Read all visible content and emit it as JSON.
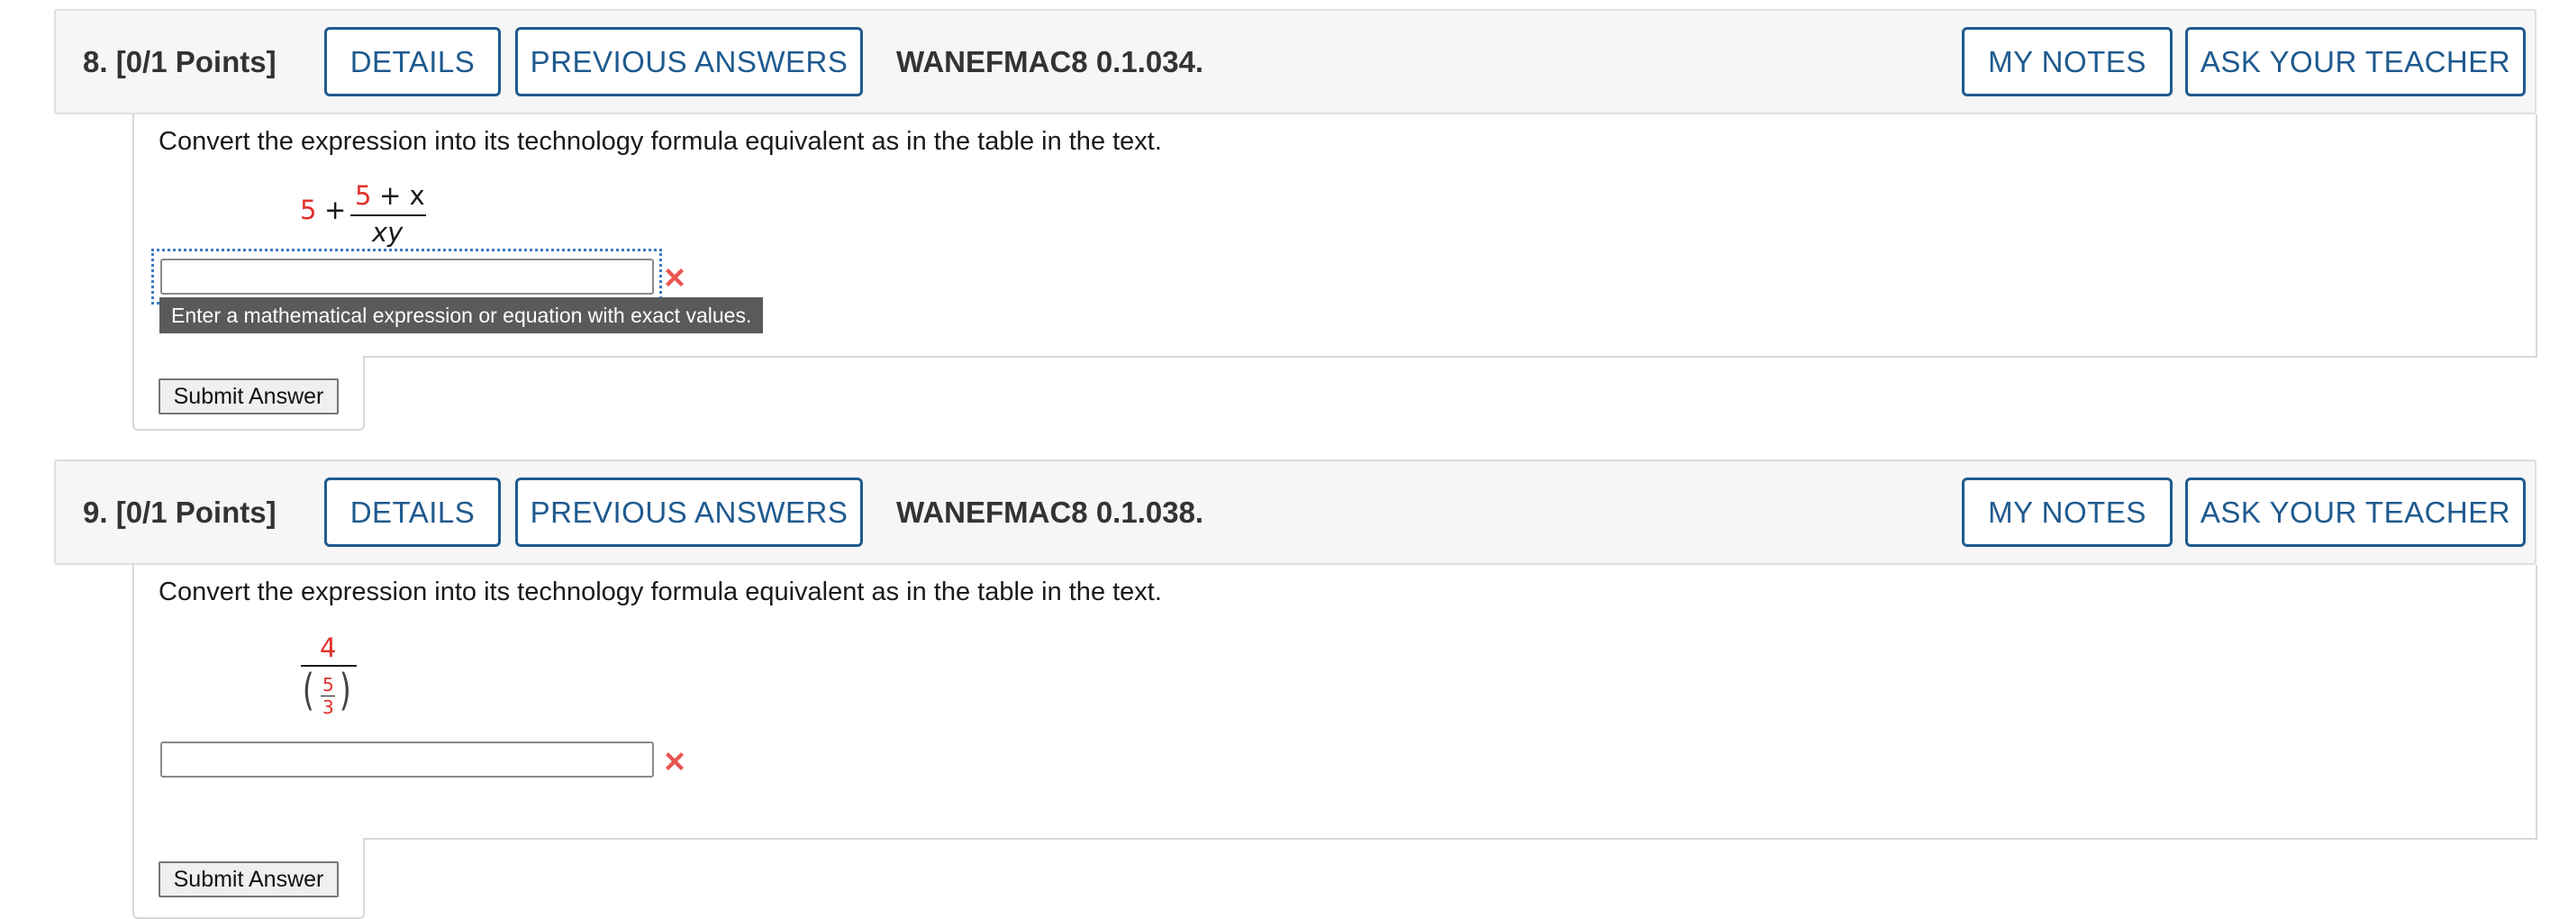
{
  "questions": [
    {
      "number_label": "8.",
      "points_label": "[0/1 Points]",
      "details_label": "DETAILS",
      "previous_answers_label": "PREVIOUS ANSWERS",
      "reference": "WANEFMAC8 0.1.034.",
      "my_notes_label": "MY NOTES",
      "ask_teacher_label": "ASK YOUR TEACHER",
      "prompt": "Convert the expression into its technology formula equivalent as in the table in the text.",
      "expression": {
        "whole": "5",
        "plus": "+",
        "numerator_a": "5",
        "numerator_op": "+ x",
        "denominator": "xy"
      },
      "answer_value": "",
      "answer_status": "incorrect-icon",
      "tooltip": "Enter a mathematical expression or equation with exact values.",
      "submit_label": "Submit Answer"
    },
    {
      "number_label": "9.",
      "points_label": "[0/1 Points]",
      "details_label": "DETAILS",
      "previous_answers_label": "PREVIOUS ANSWERS",
      "reference": "WANEFMAC8 0.1.038.",
      "my_notes_label": "MY NOTES",
      "ask_teacher_label": "ASK YOUR TEACHER",
      "prompt": "Convert the expression into its technology formula equivalent as in the table in the text.",
      "expression": {
        "numerator": "4",
        "inner_numerator": "5",
        "inner_denominator": "3",
        "left_paren": "(",
        "right_paren": ")"
      },
      "answer_value": "",
      "answer_status": "incorrect-icon",
      "submit_label": "Submit Answer"
    }
  ],
  "colors": {
    "accent": "#1f5a8f",
    "header_bg": "#f6f6f6",
    "math_red": "#e0302a",
    "error_x": "#e8554e",
    "tooltip_bg": "#5a5a5a",
    "focus_outline": "#3d79c2"
  }
}
